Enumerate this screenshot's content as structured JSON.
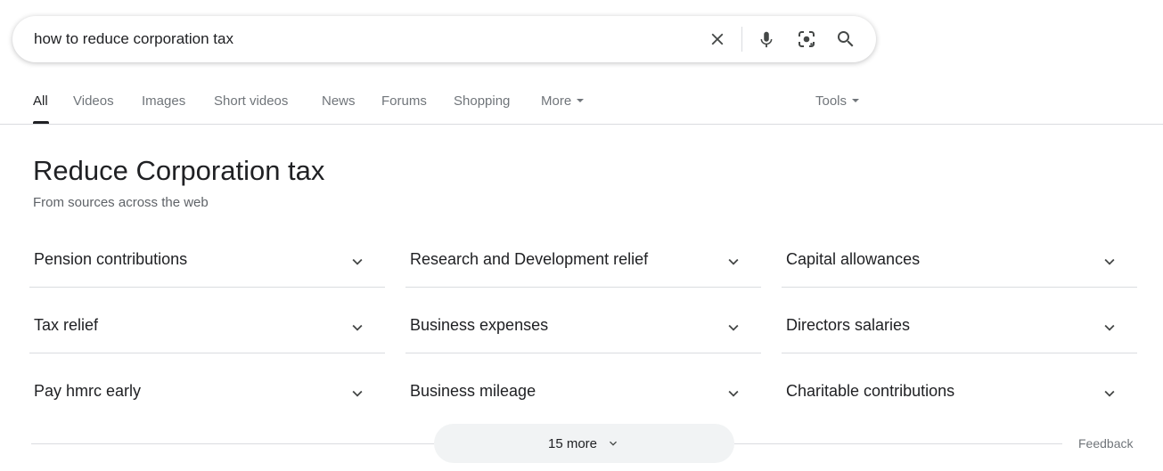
{
  "search": {
    "query": "how to reduce corporation tax"
  },
  "tabs": [
    {
      "label": "All",
      "active": true
    },
    {
      "label": "Videos"
    },
    {
      "label": "Images"
    },
    {
      "label": "Short videos"
    },
    {
      "label": "News"
    },
    {
      "label": "Forums"
    },
    {
      "label": "Shopping"
    },
    {
      "label": "More"
    }
  ],
  "tools_label": "Tools",
  "panel": {
    "title": "Reduce Corporation tax",
    "subtitle": "From sources across the web",
    "items": [
      "Pension contributions",
      "Research and Development relief",
      "Capital allowances",
      "Tax relief",
      "Business expenses",
      "Directors salaries",
      "Pay hmrc early",
      "Business mileage",
      "Charitable contributions"
    ],
    "more_label": "15 more",
    "feedback_label": "Feedback"
  },
  "icons": {
    "clear": "close-icon",
    "mic": "microphone-icon",
    "lens": "camera-lens-icon",
    "search": "search-icon",
    "expand": "chevron-down-icon"
  },
  "colors": {
    "text": "#202124",
    "secondary": "#70757a",
    "divider": "#dadce0",
    "button_bg": "#f1f3f4",
    "icon": "#444746"
  }
}
